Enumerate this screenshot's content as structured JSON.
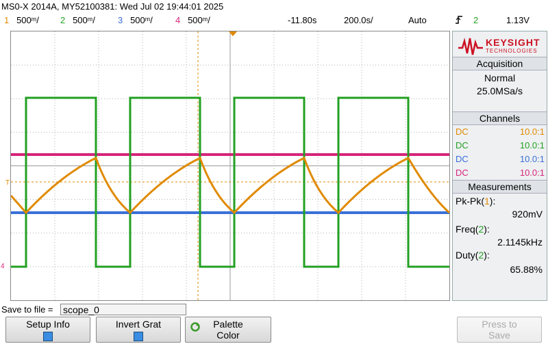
{
  "title": "MS0-X 2014A, MY52100381: Wed Jul 02 19:44:01 2025",
  "header": {
    "channels": [
      {
        "num": "1",
        "scale": "500ᵐ/",
        "color": "#e08a00"
      },
      {
        "num": "2",
        "scale": "500ᵐ/",
        "color": "#22a022"
      },
      {
        "num": "3",
        "scale": "500ᵐ/",
        "color": "#3a6fd8"
      },
      {
        "num": "4",
        "scale": "500ᵐ/",
        "color": "#d6247a"
      }
    ],
    "time_offset": "-11.80s",
    "time_scale": "200.0s/",
    "trigger_mode": "Auto",
    "trigger_icon": "trigger-edge-icon",
    "trigger_source": "2",
    "trigger_level": "1.13V"
  },
  "logo": {
    "name": "KEYSIGHT",
    "sub": "TECHNOLOGIES",
    "color": "#cc1122"
  },
  "acquisition": {
    "heading": "Acquisition",
    "mode": "Normal",
    "rate": "25.0MSa/s"
  },
  "channels_panel": {
    "heading": "Channels",
    "rows": [
      {
        "coupling": "DC",
        "probe": "10.0:1",
        "color": "#e08a00"
      },
      {
        "coupling": "DC",
        "probe": "10.0:1",
        "color": "#22a022"
      },
      {
        "coupling": "DC",
        "probe": "10.0:1",
        "color": "#3a6fd8"
      },
      {
        "coupling": "DC",
        "probe": "10.0:1",
        "color": "#d6247a"
      }
    ]
  },
  "measurements": {
    "heading": "Measurements",
    "items": [
      {
        "label": "Pk-Pk(",
        "ch": "1",
        "close": "):",
        "value": "920mV",
        "ch_color": "#e08a00"
      },
      {
        "label": "Freq(",
        "ch": "2",
        "close": "):",
        "value": "2.1145kHz",
        "ch_color": "#22a022"
      },
      {
        "label": "Duty(",
        "ch": "2",
        "close": "):",
        "value": "65.88%",
        "ch_color": "#22a022"
      }
    ]
  },
  "markers": {
    "trigger_T": "T",
    "gnd_label": "4",
    "ch1_marker": "1"
  },
  "save": {
    "label": "Save to file =",
    "filename": "scope_0"
  },
  "softkeys": [
    {
      "label": "Setup Info",
      "type": "check"
    },
    {
      "label": "Invert Grat",
      "type": "check"
    },
    {
      "label": "Palette",
      "sub": "Color",
      "type": "cycle"
    },
    {
      "label": "Press to",
      "sub": "Save",
      "type": "disabled"
    }
  ]
}
